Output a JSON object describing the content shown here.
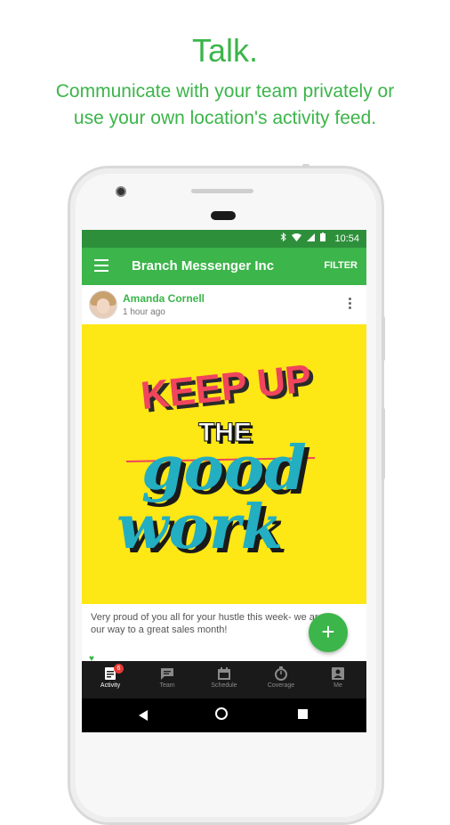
{
  "promo": {
    "title": "Talk.",
    "subtitle_line1": "Communicate with your team privately or",
    "subtitle_line2": "use your own location's activity feed."
  },
  "status_bar": {
    "time": "10:54"
  },
  "app_bar": {
    "title": "Branch Messenger Inc",
    "filter_label": "FILTER"
  },
  "post": {
    "author": "Amanda Cornell",
    "time": "1 hour ago",
    "image_lettering": [
      "KEEP UP",
      "THE",
      "good",
      "work"
    ],
    "body": "Very proud of you all for your hustle this week- we are on our way to a great sales month!"
  },
  "tabs": [
    {
      "label": "Activity",
      "icon": "activity-icon",
      "badge": "6",
      "active": true
    },
    {
      "label": "Team",
      "icon": "chat-icon",
      "active": false
    },
    {
      "label": "Schedule",
      "icon": "calendar-icon",
      "active": false
    },
    {
      "label": "Coverage",
      "icon": "stopwatch-icon",
      "active": false
    },
    {
      "label": "Me",
      "icon": "profile-icon",
      "active": false
    }
  ],
  "colors": {
    "brand_green": "#3cb54a",
    "status_green": "#2e8f3b",
    "image_yellow": "#fde715"
  }
}
